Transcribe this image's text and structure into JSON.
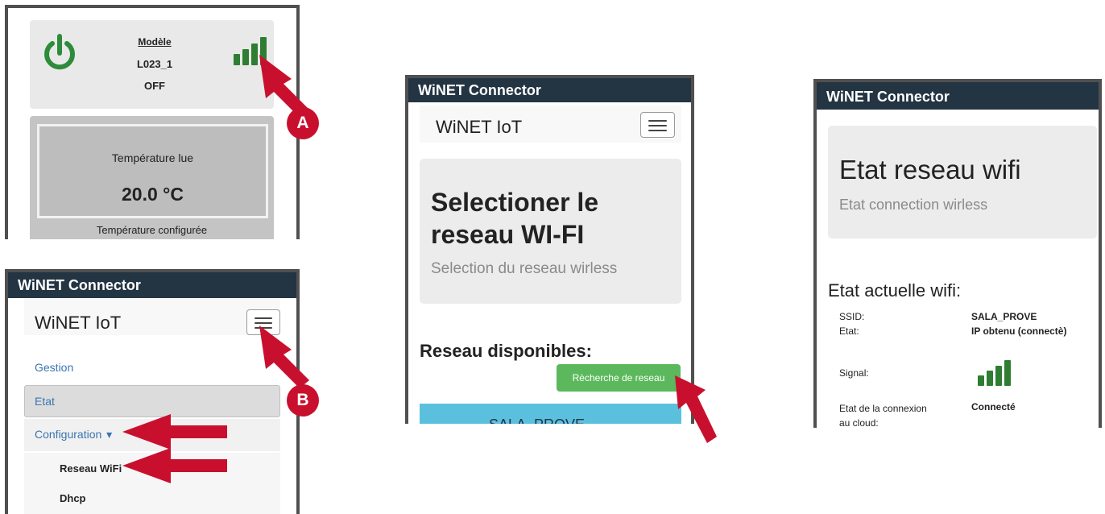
{
  "panel1": {
    "model_label": "Modèle",
    "model_value": "L023_1",
    "power_state": "OFF",
    "temp_read_label": "Température lue",
    "temp_read_value": "20.0 °C",
    "temp_config_label": "Température configurée"
  },
  "panel2": {
    "app_title": "WiNET Connector",
    "brand": "WiNET IoT",
    "menu": {
      "gestion": "Gestion",
      "etat": "Etat",
      "configuration": "Configuration",
      "configuration_caret": "▾",
      "reseau_wifi": "Reseau WiFi",
      "dhcp": "Dhcp"
    }
  },
  "panel3": {
    "app_title": "WiNET Connector",
    "brand": "WiNET IoT",
    "hero_title": "Selectioner le reseau WI-FI",
    "hero_subtitle": "Selection du reseau wirless",
    "section_title": "Reseau disponibles:",
    "search_button": "Rècherche de reseau",
    "network_partial": "SALA_PROVE"
  },
  "panel4": {
    "app_title": "WiNET Connector",
    "hero_title": "Etat reseau wifi",
    "hero_subtitle": "Etat connection wirless",
    "section_title": "Etat actuelle wifi:",
    "rows": {
      "ssid_label": "SSID:",
      "ssid_value": "SALA_PROVE",
      "etat_label": "Etat:",
      "etat_value": "IP obtenu (connectè)",
      "signal_label": "Signal:",
      "cloud_label_1": "Etat de la connexion",
      "cloud_label_2": "au cloud:",
      "cloud_value": "Connecté"
    }
  },
  "callouts": {
    "a": "A",
    "b": "B"
  },
  "colors": {
    "titlebar": "#233443",
    "signal_green": "#2e7d32",
    "power_green": "#2e8b3a",
    "search_button": "#5cb85c",
    "network_item": "#5bc0de",
    "arrow_red": "#c8102e"
  },
  "icons": {
    "power": "power-icon",
    "signal": "signal-bars-icon",
    "menu": "hamburger-menu-icon",
    "caret": "caret-down-icon"
  }
}
